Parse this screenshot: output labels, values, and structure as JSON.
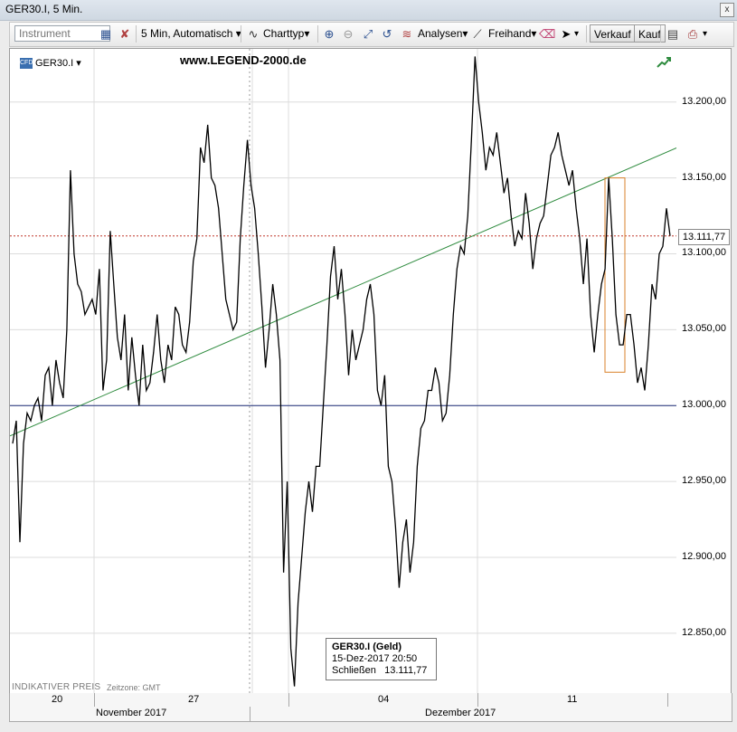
{
  "window": {
    "title": "GER30.I, 5 Min.",
    "close_glyph": "x"
  },
  "toolbar": {
    "instrument_placeholder": "Instrument",
    "interval_label": "5 Min, Automatisch",
    "charttype_label": "Charttyp",
    "analysen_label": "Analysen",
    "freihand_label": "Freihand",
    "verkauf_label": "Verkauf",
    "kauf_label": "Kauf"
  },
  "chart": {
    "symbol": "GER30.I",
    "watermark": "www.LEGEND-2000.de",
    "indicative_label": "INDIKATIVER PREIS",
    "timezone_label": "Zeitzone: GMT",
    "current_price_label": "13.111,77",
    "tooltip": {
      "title": "GER30.I (Geld)",
      "datetime": "15-Dez-2017 20:50",
      "close_label": "Schließen",
      "close_value": "13.111,77"
    }
  },
  "chart_data": {
    "type": "line",
    "series": [
      {
        "values": [
          12975,
          12990,
          12910,
          12975,
          12995,
          12990,
          13000,
          13005,
          12990,
          13020,
          13025,
          13000,
          13030,
          13015,
          13005,
          13050,
          13155,
          13100,
          13080,
          13075,
          13060,
          13065,
          13070,
          13060,
          13090,
          13010,
          13030,
          13115,
          13080,
          13045,
          13030,
          13060,
          13010,
          13045,
          13020,
          13000,
          13040,
          13010,
          13015,
          13035,
          13060,
          13030,
          13015,
          13040,
          13030,
          13065,
          13060,
          13040,
          13035,
          13055,
          13095,
          13110,
          13170,
          13160,
          13185,
          13150,
          13145,
          13130,
          13100,
          13070,
          13060,
          13050,
          13055,
          13110,
          13145,
          13175,
          13145,
          13130,
          13100,
          13065,
          13025,
          13050,
          13080,
          13060,
          13030,
          12890,
          12950,
          12840,
          12815,
          12870,
          12900,
          12930,
          12950,
          12930,
          12960,
          12960,
          13000,
          13040,
          13085,
          13105,
          13070,
          13090,
          13060,
          13020,
          13050,
          13030,
          13040,
          13050,
          13070,
          13080,
          13060,
          13010,
          13000,
          13020,
          12960,
          12950,
          12920,
          12880,
          12910,
          12925,
          12890,
          12910,
          12960,
          12985,
          12990,
          13010,
          13010,
          13025,
          13015,
          12990,
          12995,
          13020,
          13060,
          13090,
          13105,
          13100,
          13125,
          13175,
          13230,
          13200,
          13180,
          13155,
          13170,
          13165,
          13180,
          13160,
          13140,
          13150,
          13125,
          13105,
          13115,
          13110,
          13140,
          13120,
          13090,
          13110,
          13120,
          13125,
          13145,
          13165,
          13170,
          13180,
          13165,
          13155,
          13145,
          13155,
          13130,
          13110,
          13080,
          13110,
          13060,
          13035,
          13060,
          13080,
          13090,
          13150,
          13110,
          13060,
          13040,
          13040,
          13060,
          13060,
          13040,
          13015,
          13025,
          13010,
          13040,
          13080,
          13070,
          13100,
          13105,
          13130,
          13111.77
        ]
      }
    ],
    "x_ticks": [
      "20",
      "27",
      "04",
      "11"
    ],
    "x_months": [
      "November 2017",
      "Dezember 2017"
    ],
    "y_ticks": [
      "13.200,00",
      "13.150,00",
      "13.100,00",
      "13.050,00",
      "13.000,00",
      "12.950,00",
      "12.900,00",
      "12.850,00"
    ],
    "ylim": [
      12810,
      13235
    ],
    "horizontal_lines": [
      {
        "value": 13000,
        "color": "#1f2f7a"
      },
      {
        "value": 13111.77,
        "color": "#c0392b"
      }
    ],
    "trendline": {
      "y_start": 12980,
      "y_end": 13170,
      "color": "#2e8b3e"
    },
    "highlight_box": {
      "y_low": 13022,
      "y_high": 13150,
      "color": "#d9822b"
    },
    "line_color": "#000000",
    "grid": true
  }
}
